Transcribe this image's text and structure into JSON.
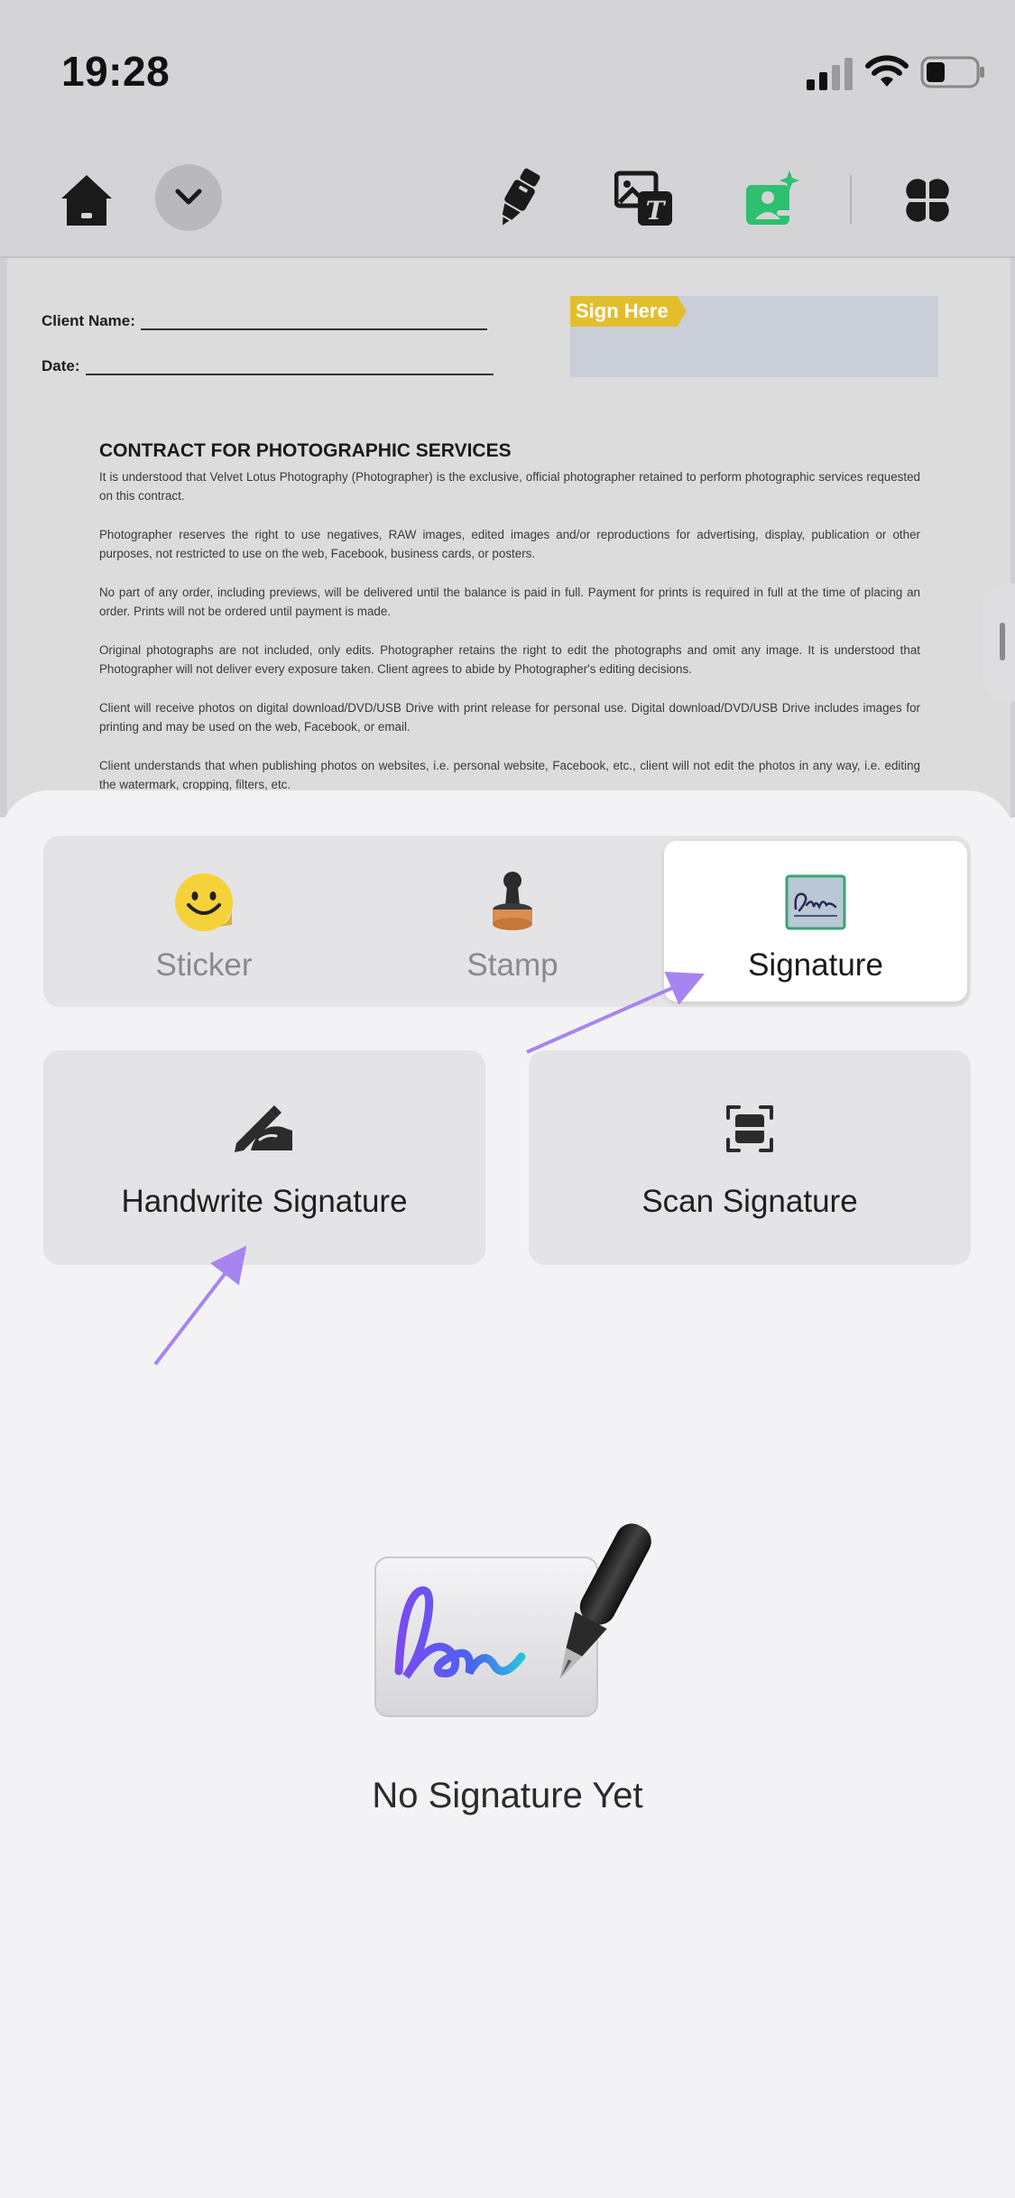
{
  "status_bar": {
    "time": "19:28"
  },
  "toolbar": {
    "icons": [
      "home-icon",
      "chevron-down-icon",
      "highlighter-icon",
      "image-text-icon",
      "image-sign-icon",
      "apps-icon"
    ],
    "active_color": "#2fbf71"
  },
  "document": {
    "client_name_label": "Client Name:",
    "date_label": "Date:",
    "sign_here_tag": "Sign Here",
    "title": "CONTRACT FOR PHOTOGRAPHIC SERVICES",
    "paragraphs": [
      "It is understood that Velvet Lotus Photography (Photographer) is the exclusive, official photographer retained to perform photographic services requested on this contract.",
      "Photographer reserves the right to use negatives, RAW images, edited images and/or reproductions for advertising, display, publication or other purposes, not restricted to use on the web, Facebook, business cards, or posters.",
      "No part of any order, including previews, will be delivered until the balance is paid in full. Payment for prints is required in full at the time of placing an order. Prints will not be ordered until payment is made.",
      "Original photographs are not included, only edits. Photographer retains the right to edit the photographs and omit any image. It is understood that Photographer will not deliver every exposure taken. Client agrees to abide by Photographer's editing decisions.",
      "Client will receive photos on digital download/DVD/USB Drive with print release for personal use. Digital download/DVD/USB Drive includes images for printing and may be used on the web, Facebook, or email.",
      "Client understands that when publishing photos on websites, i.e. personal website, Facebook, etc., client will not edit the photos in any way, i.e. editing the watermark, cropping, filters, etc."
    ]
  },
  "sheet": {
    "segments": [
      {
        "label": "Sticker",
        "icon": "smiley-sticker-icon",
        "selected": false
      },
      {
        "label": "Stamp",
        "icon": "rubber-stamp-icon",
        "selected": false
      },
      {
        "label": "Signature",
        "icon": "signature-card-icon",
        "selected": true
      }
    ],
    "actions": [
      {
        "label": "Handwrite Signature",
        "icon": "hand-pen-icon"
      },
      {
        "label": "Scan Signature",
        "icon": "scan-icon"
      }
    ],
    "empty_state": {
      "text": "No Signature Yet",
      "illustration": "signature-pen-illustration-icon"
    },
    "annotation_arrow_color": "#a784f0"
  }
}
